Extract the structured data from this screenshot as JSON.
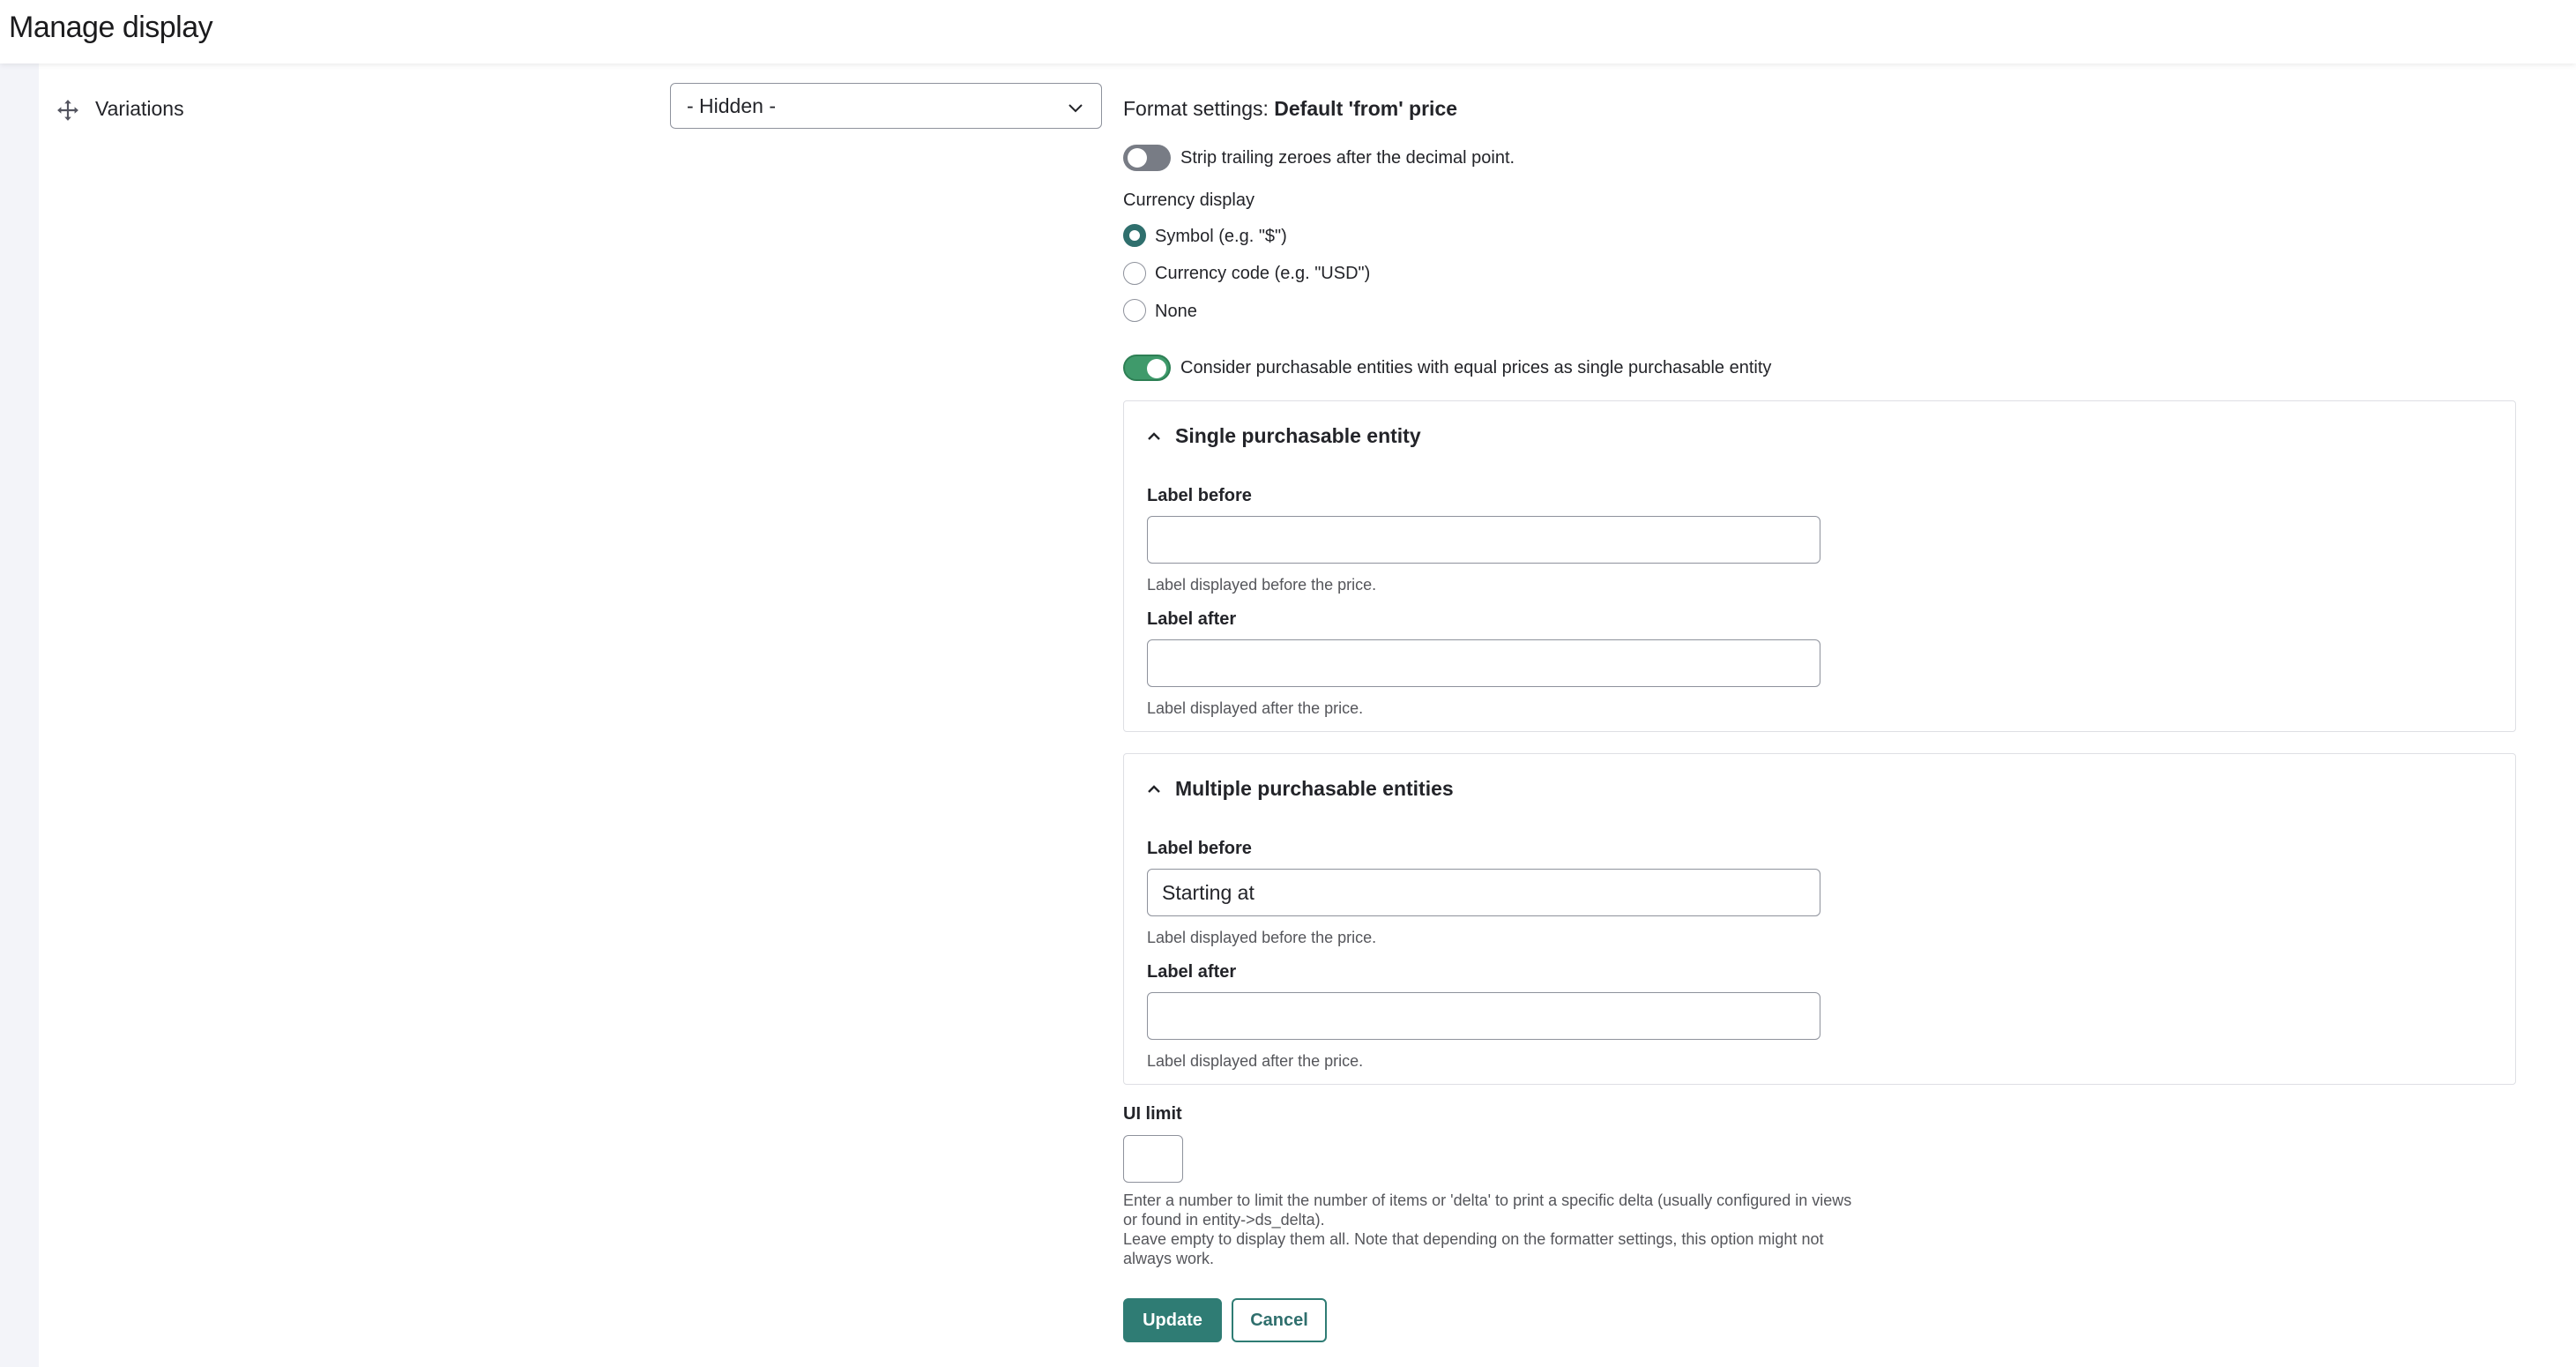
{
  "header": {
    "title": "Manage display"
  },
  "row": {
    "field_label": "Variations",
    "region_select": {
      "selected": "- Hidden -"
    }
  },
  "format_settings": {
    "prefix": "Format settings:",
    "formatter_name": "Default 'from' price"
  },
  "strip_zeroes": {
    "label": "Strip trailing zeroes after the decimal point.",
    "enabled": false
  },
  "currency_display": {
    "title": "Currency display",
    "options": [
      {
        "label": "Symbol (e.g. \"$\")",
        "checked": true
      },
      {
        "label": "Currency code (e.g. \"USD\")",
        "checked": false
      },
      {
        "label": "None",
        "checked": false
      }
    ]
  },
  "equal_prices": {
    "label": "Consider purchasable entities with equal prices as single purchasable entity",
    "enabled": true
  },
  "single": {
    "legend": "Single purchasable entity",
    "label_before": {
      "title": "Label before",
      "value": "",
      "help": "Label displayed before the price."
    },
    "label_after": {
      "title": "Label after",
      "value": "",
      "help": "Label displayed after the price."
    }
  },
  "multiple": {
    "legend": "Multiple purchasable entities",
    "label_before": {
      "title": "Label before",
      "value": "Starting at",
      "help": "Label displayed before the price."
    },
    "label_after": {
      "title": "Label after",
      "value": "",
      "help": "Label displayed after the price."
    }
  },
  "ui_limit": {
    "title": "UI limit",
    "value": "",
    "help_lines": [
      "Enter a number to limit the number of items or 'delta' to print a specific delta (usually configured in views",
      "or found in entity->ds_delta).",
      "Leave empty to display them all. Note that depending on the formatter settings, this option might not",
      "always work."
    ]
  },
  "actions": {
    "update_label": "Update",
    "cancel_label": "Cancel"
  },
  "colors": {
    "accent": "#2f7c74",
    "toggle_on": "#3f9a6b",
    "toggle_off": "#787c85"
  }
}
